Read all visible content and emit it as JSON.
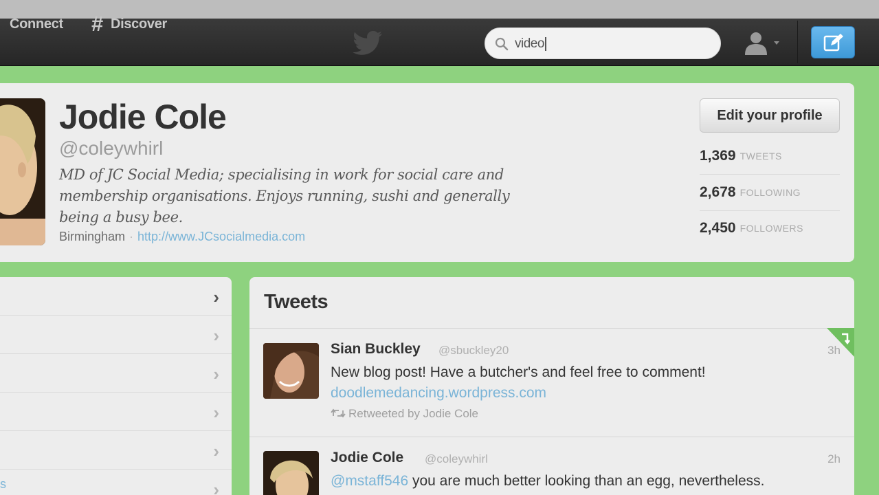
{
  "nav": {
    "connect_label": "Connect",
    "discover_label": "Discover",
    "search_query": "video"
  },
  "profile": {
    "name": "Jodie Cole",
    "handle": "@coleywhirl",
    "bio_lines": [
      "MD of JC Social Media; specialising in work for social care and",
      "membership organisations. Enjoys running, sushi and generally",
      "being a busy bee."
    ],
    "location": "Birmingham",
    "separator": "·",
    "url": "http://www.JCsocialmedia.com",
    "edit_button": "Edit your profile",
    "stats": [
      {
        "value": "1,369",
        "label": "TWEETS"
      },
      {
        "value": "2,678",
        "label": "FOLLOWING"
      },
      {
        "value": "2,450",
        "label": "FOLLOWERS"
      }
    ]
  },
  "sidebar": {
    "chevron": "›",
    "partial_link": "s"
  },
  "tweets": {
    "title": "Tweets",
    "items": [
      {
        "name": "Sian Buckley",
        "handle": "@sbuckley20",
        "time": "3h",
        "text": "New blog post! Have a butcher's and feel free to comment!",
        "link": "doodlemedancing.wordpress.com",
        "retweeted_by": "Retweeted by Jodie Cole"
      },
      {
        "name": "Jodie Cole",
        "handle": "@coleywhirl",
        "time": "2h",
        "mention": "@mstaff546",
        "text": " you are much better looking than an egg, nevertheless."
      }
    ]
  },
  "colors": {
    "background_green": "#8ed27f",
    "navbar": "#2e2e2e",
    "link_blue": "#7ab4d7",
    "compose_blue": "#4ca6e0"
  }
}
